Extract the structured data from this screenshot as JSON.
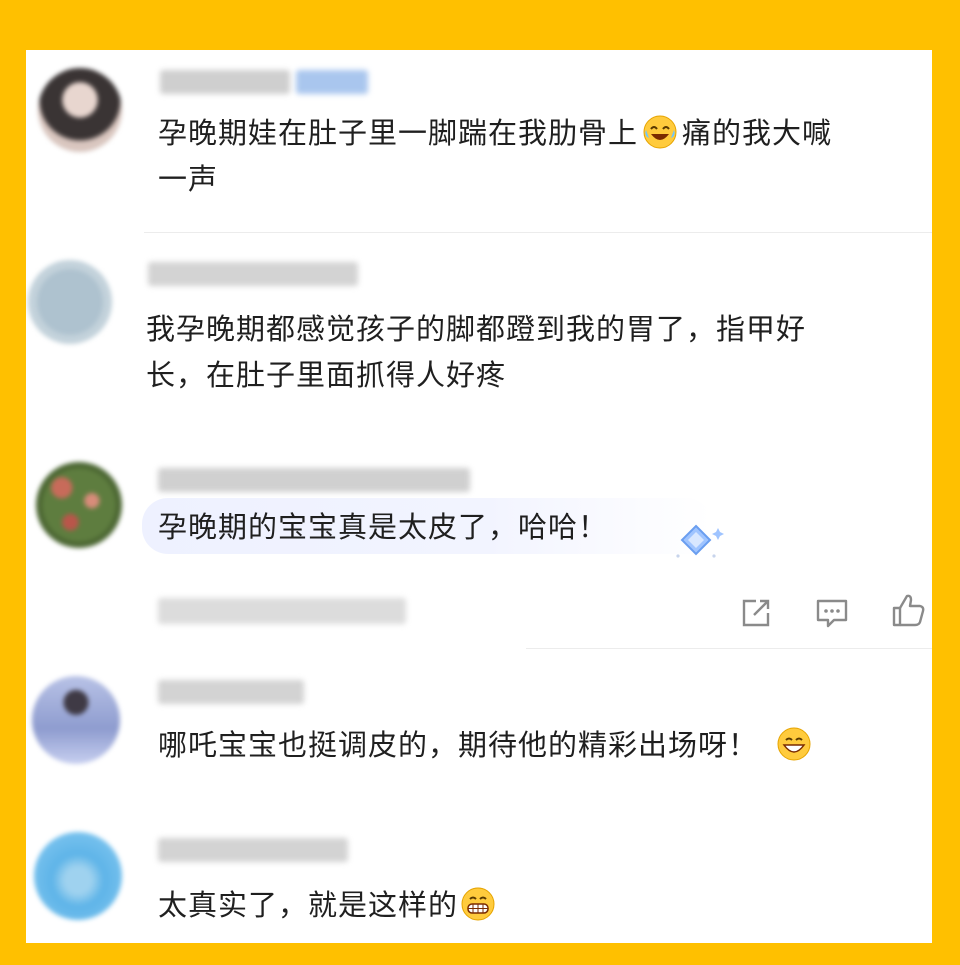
{
  "colors": {
    "frame": "#FFC000",
    "card": "#FFFFFF",
    "text": "#1F1F1F",
    "icon": "#8a8a8a",
    "highlight": "#EEF1FF"
  },
  "comments": [
    {
      "text_a": "孕晚期娃在肚子里一脚踹在我肋骨上",
      "emoji_mid": "laugh-cry-emoji",
      "text_b": "痛的我大喊",
      "text_c": "一声"
    },
    {
      "text_a": "我孕晚期都感觉孩子的脚都蹬到我的胃了，指甲好",
      "text_b": "长，在肚子里面抓得人好疼"
    },
    {
      "text_a": "孕晚期的宝宝真是太皮了，哈哈！",
      "actions": [
        "share-icon",
        "reply-icon",
        "like-icon"
      ]
    },
    {
      "text_a": "哪吒宝宝也挺调皮的，期待他的精彩出场呀！",
      "emoji_end": "grinning-emoji"
    },
    {
      "text_a": "太真实了，就是这样的",
      "emoji_end": "big-grin-emoji"
    }
  ]
}
